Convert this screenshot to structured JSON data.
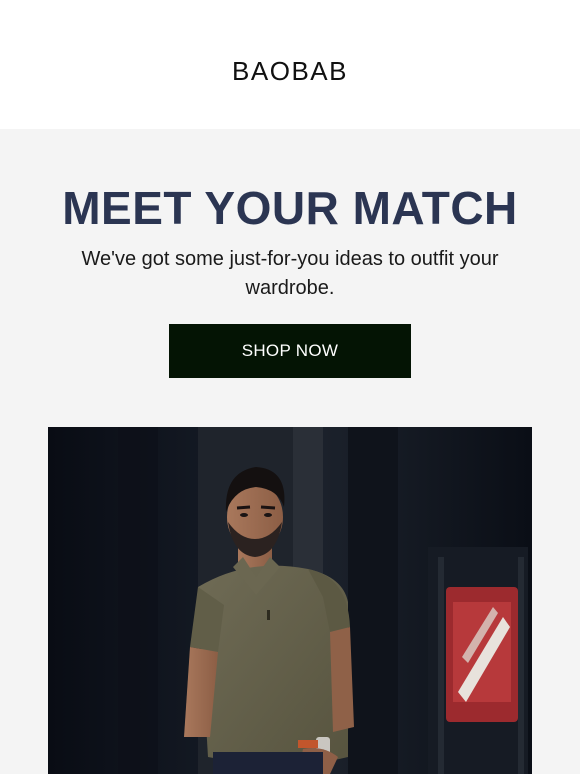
{
  "header": {
    "logo_text": "BAOBAB"
  },
  "hero": {
    "headline": "MEET YOUR MATCH",
    "subtext": "We've got some just-for-you ideas to outfit your wardrobe.",
    "cta_label": "SHOP NOW"
  },
  "colors": {
    "background": "#f4f4f4",
    "headline": "#2b3552",
    "cta_background": "#041404",
    "cta_text": "#ffffff"
  },
  "image": {
    "subject": "man-in-olive-polo-shirt"
  }
}
